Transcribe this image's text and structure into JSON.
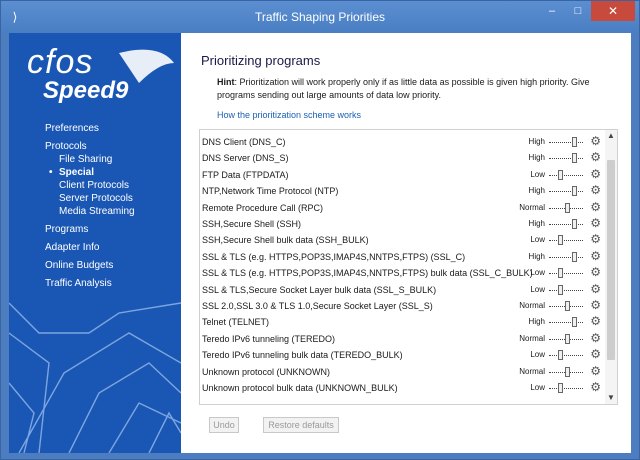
{
  "window": {
    "title": "Traffic Shaping Priorities",
    "minimize_icon": "minimize-icon",
    "maximize_icon": "maximize-icon",
    "close_icon": "close-icon",
    "minimize_glyph": "–",
    "maximize_glyph": "□",
    "close_glyph": "✕"
  },
  "logo": {
    "line1": "cfos",
    "line2": "Speed",
    "version": "9"
  },
  "sidebar": {
    "items": [
      {
        "label": "Preferences",
        "level": 0
      },
      {
        "label": "Protocols",
        "level": 0
      },
      {
        "label": "File Sharing",
        "level": 1
      },
      {
        "label": "Special",
        "level": 1,
        "active": true
      },
      {
        "label": "Client Protocols",
        "level": 1
      },
      {
        "label": "Server Protocols",
        "level": 1
      },
      {
        "label": "Media Streaming",
        "level": 1
      },
      {
        "label": "Programs",
        "level": 0
      },
      {
        "label": "Adapter Info",
        "level": 0
      },
      {
        "label": "Online Budgets",
        "level": 0
      },
      {
        "label": "Traffic Analysis",
        "level": 0
      }
    ]
  },
  "main": {
    "heading": "Prioritizing programs",
    "hint_label": "Hint",
    "hint_text": ": Prioritization will work properly only if as little data as possible is given high priority. Give programs sending out large amounts of data low priority.",
    "link": "How the prioritization scheme works"
  },
  "priority_levels": {
    "High": 0.8,
    "Normal": 0.55,
    "Low": 0.3
  },
  "rows": [
    {
      "name": "DNS Client (DNS_C)",
      "priority": "High"
    },
    {
      "name": "DNS Server (DNS_S)",
      "priority": "High"
    },
    {
      "name": "FTP Data (FTPDATA)",
      "priority": "Low"
    },
    {
      "name": "NTP,Network Time Protocol (NTP)",
      "priority": "High"
    },
    {
      "name": "Remote Procedure Call (RPC)",
      "priority": "Normal"
    },
    {
      "name": "SSH,Secure Shell (SSH)",
      "priority": "High"
    },
    {
      "name": "SSH,Secure Shell bulk data (SSH_BULK)",
      "priority": "Low"
    },
    {
      "name": "SSL & TLS (e.g. HTTPS,POP3S,IMAP4S,NNTPS,FTPS) (SSL_C)",
      "priority": "High"
    },
    {
      "name": "SSL & TLS (e.g. HTTPS,POP3S,IMAP4S,NNTPS,FTPS) bulk data (SSL_C_BULK)",
      "priority": "Low"
    },
    {
      "name": "SSL & TLS,Secure Socket Layer bulk data (SSL_S_BULK)",
      "priority": "Low"
    },
    {
      "name": "SSL 2.0,SSL 3.0 & TLS 1.0,Secure Socket Layer (SSL_S)",
      "priority": "Normal"
    },
    {
      "name": "Telnet (TELNET)",
      "priority": "High"
    },
    {
      "name": "Teredo IPv6 tunneling (TEREDO)",
      "priority": "Normal"
    },
    {
      "name": "Teredo IPv6 tunneling bulk data (TEREDO_BULK)",
      "priority": "Low"
    },
    {
      "name": "Unknown protocol (UNKNOWN)",
      "priority": "Normal"
    },
    {
      "name": "Unknown protocol bulk data (UNKNOWN_BULK)",
      "priority": "Low"
    }
  ],
  "buttons": {
    "undo": "Undo",
    "restore": "Restore defaults"
  },
  "icons": {
    "gear": "gear-icon",
    "scroll_up": "scroll-up-icon",
    "scroll_down": "scroll-down-icon"
  }
}
